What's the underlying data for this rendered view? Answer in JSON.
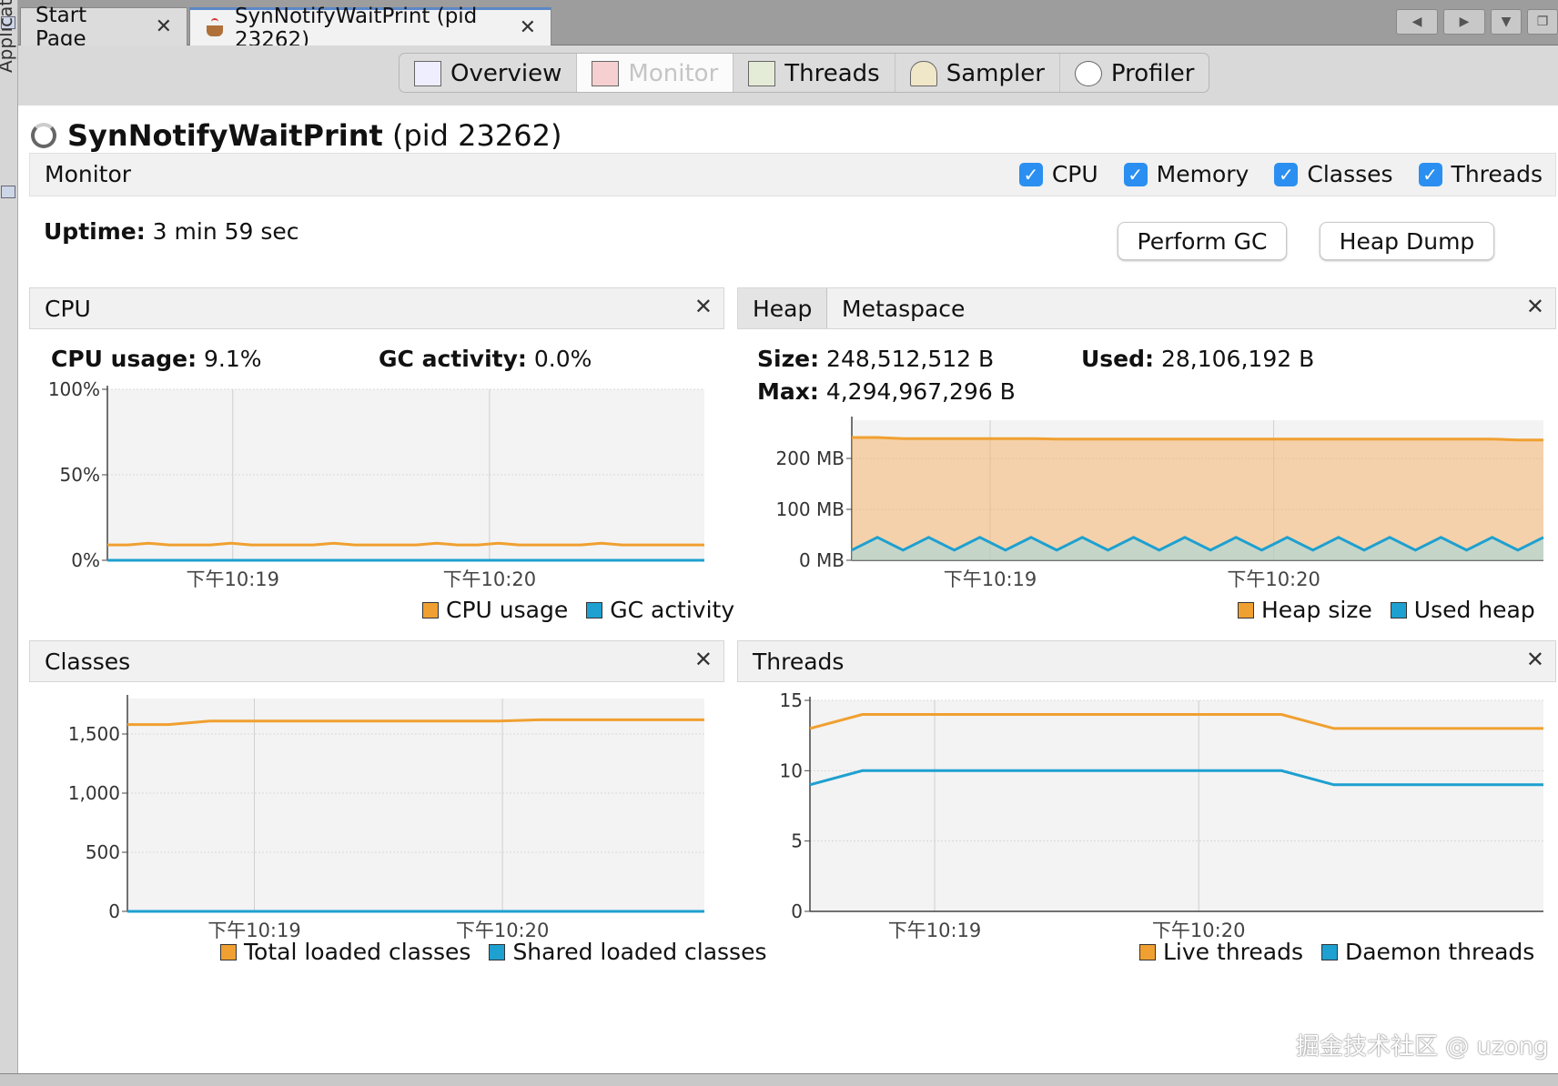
{
  "sidebar": {
    "label": "Applications"
  },
  "tabs": [
    {
      "label": "Start Page",
      "close": "✕"
    },
    {
      "label": "SynNotifyWaitPrint (pid 23262)",
      "close": "✕"
    }
  ],
  "window_buttons": [
    "◀",
    "▶",
    "▼",
    "❐"
  ],
  "views": [
    {
      "label": "Overview"
    },
    {
      "label": "Monitor"
    },
    {
      "label": "Threads"
    },
    {
      "label": "Sampler"
    },
    {
      "label": "Profiler"
    }
  ],
  "app": {
    "name": "SynNotifyWaitPrint",
    "pid": "(pid 23262)"
  },
  "monitor": {
    "title": "Monitor",
    "checks": [
      {
        "label": "CPU",
        "checked": true
      },
      {
        "label": "Memory",
        "checked": true
      },
      {
        "label": "Classes",
        "checked": true
      },
      {
        "label": "Threads",
        "checked": true
      }
    ],
    "uptime_label": "Uptime:",
    "uptime_value": "3 min 59 sec",
    "perform_gc": "Perform GC",
    "heap_dump": "Heap Dump"
  },
  "cpu_panel": {
    "title": "CPU",
    "close": "✕",
    "usage_label": "CPU usage:",
    "usage_value": "9.1%",
    "gc_label": "GC activity:",
    "gc_value": "0.0%"
  },
  "heap_panel": {
    "tab_heap": "Heap",
    "tab_meta": "Metaspace",
    "close": "✕",
    "size_label": "Size:",
    "size_value": "248,512,512 B",
    "used_label": "Used:",
    "used_value": "28,106,192 B",
    "max_label": "Max:",
    "max_value": "4,294,967,296 B"
  },
  "classes_panel": {
    "title": "Classes",
    "close": "✕"
  },
  "threads_panel": {
    "title": "Threads",
    "close": "✕"
  },
  "colors": {
    "orange": "#f0a030",
    "blue": "#1ea0d0",
    "accent": "#2a8ff0"
  },
  "watermark": "掘金技术社区 @ uzong",
  "chart_data": [
    {
      "type": "line",
      "id": "cpu",
      "x_ticks": [
        "下午10:19",
        "下午10:20"
      ],
      "y_ticks": [
        "100%",
        "50%",
        "0%"
      ],
      "ylim": [
        0,
        100
      ],
      "series": [
        {
          "name": "CPU usage",
          "values": [
            9,
            9,
            10,
            9,
            9,
            9,
            10,
            9,
            9,
            9,
            9,
            10,
            9,
            9,
            9,
            9,
            10,
            9,
            9,
            10,
            9,
            9,
            9,
            9,
            10,
            9,
            9,
            9,
            9,
            9
          ]
        },
        {
          "name": "GC activity",
          "values": [
            0,
            0,
            0,
            0,
            0,
            0,
            0,
            0,
            0,
            0,
            0,
            0,
            0,
            0,
            0,
            0,
            0,
            0,
            0,
            0,
            0,
            0,
            0,
            0,
            0,
            0,
            0,
            0,
            0,
            0
          ]
        }
      ]
    },
    {
      "type": "area",
      "id": "heap",
      "x_ticks": [
        "下午10:19",
        "下午10:20"
      ],
      "y_ticks": [
        "200 MB",
        "100 MB",
        "0 MB"
      ],
      "ylim": [
        0,
        275
      ],
      "series": [
        {
          "name": "Heap size",
          "values": [
            241,
            241,
            239,
            239,
            239,
            239,
            239,
            239,
            238,
            238,
            238,
            238,
            238,
            238,
            238,
            238,
            238,
            238,
            238,
            238,
            238,
            238,
            238,
            238,
            238,
            238,
            236,
            236
          ]
        },
        {
          "name": "Used heap",
          "values": [
            20,
            45,
            20,
            45,
            20,
            45,
            20,
            45,
            20,
            45,
            20,
            45,
            20,
            45,
            20,
            45,
            20,
            45,
            20,
            45,
            20,
            45,
            20,
            45,
            20,
            45,
            20,
            45
          ]
        }
      ]
    },
    {
      "type": "line",
      "id": "classes",
      "x_ticks": [
        "下午10:19",
        "下午10:20"
      ],
      "y_ticks": [
        "1,500",
        "1,000",
        "500",
        "0"
      ],
      "ylim": [
        0,
        1800
      ],
      "series": [
        {
          "name": "Total loaded classes",
          "values": [
            1580,
            1580,
            1610,
            1610,
            1610,
            1610,
            1610,
            1610,
            1610,
            1610,
            1620,
            1620,
            1620,
            1620,
            1620
          ]
        },
        {
          "name": "Shared loaded classes",
          "values": [
            0,
            0,
            0,
            0,
            0,
            0,
            0,
            0,
            0,
            0,
            0,
            0,
            0,
            0,
            0
          ]
        }
      ]
    },
    {
      "type": "line",
      "id": "threads",
      "x_ticks": [
        "下午10:19",
        "下午10:20"
      ],
      "y_ticks": [
        "15",
        "10",
        "5",
        "0"
      ],
      "ylim": [
        0,
        15
      ],
      "series": [
        {
          "name": "Live threads",
          "values": [
            13,
            14,
            14,
            14,
            14,
            14,
            14,
            14,
            14,
            14,
            13,
            13,
            13,
            13,
            13
          ]
        },
        {
          "name": "Daemon threads",
          "values": [
            9,
            10,
            10,
            10,
            10,
            10,
            10,
            10,
            10,
            10,
            9,
            9,
            9,
            9,
            9
          ]
        }
      ]
    }
  ]
}
